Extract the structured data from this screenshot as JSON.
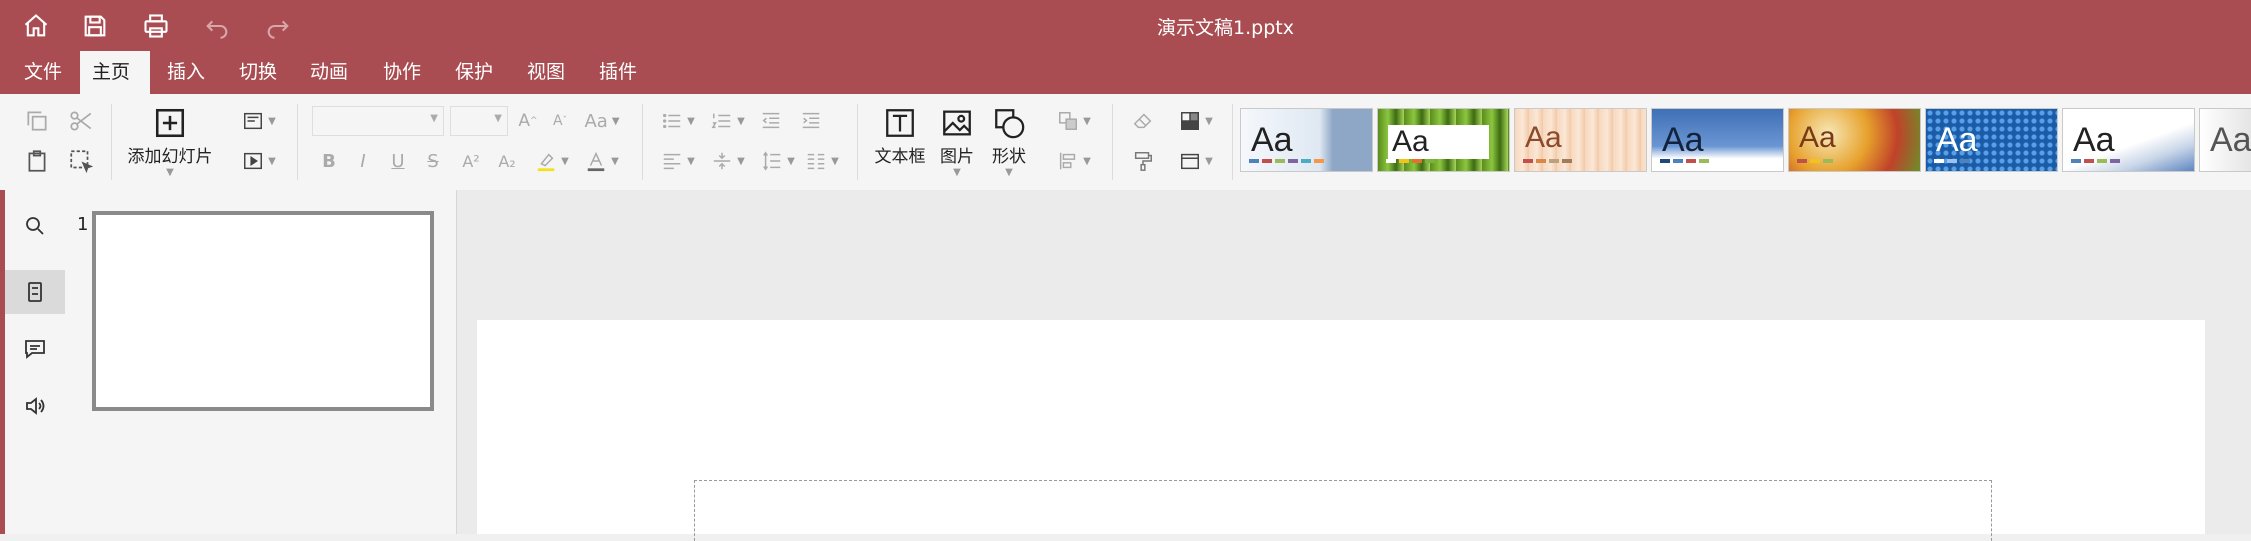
{
  "colors": {
    "accent": "#a94d52",
    "ribbon_bg": "#f5f5f5",
    "canvas_bg": "#ebebeb"
  },
  "titlebar": {
    "document_title": "演示文稿1.pptx",
    "quick_access": [
      "home-icon",
      "save-icon",
      "print-icon",
      "undo-icon",
      "redo-icon"
    ]
  },
  "menu": {
    "items": [
      {
        "label": "文件"
      },
      {
        "label": "主页",
        "active": true
      },
      {
        "label": "插入"
      },
      {
        "label": "切换"
      },
      {
        "label": "动画"
      },
      {
        "label": "协作"
      },
      {
        "label": "保护"
      },
      {
        "label": "视图"
      },
      {
        "label": "插件"
      }
    ]
  },
  "ribbon": {
    "add_slide_label": "添加幻灯片",
    "font_size_decrease_label": "A",
    "font_size_increase_label": "A",
    "change_case_label": "Aa",
    "bold_label": "B",
    "italic_label": "I",
    "underline_label": "U",
    "strike_label": "S",
    "superscript_label": "A²",
    "subscript_label": "A₂",
    "textbox_label": "文本框",
    "picture_label": "图片",
    "shape_label": "形状",
    "themes": [
      {
        "label": "Aa"
      },
      {
        "label": "Aa"
      },
      {
        "label": "Aa"
      },
      {
        "label": "Aa"
      },
      {
        "label": "Aa"
      },
      {
        "label": "Aa"
      },
      {
        "label": "Aa"
      },
      {
        "label": "Aa"
      }
    ]
  },
  "slides_panel": {
    "slides": [
      {
        "number": "1"
      }
    ]
  },
  "left_nav": [
    "search-icon",
    "slides-icon",
    "comment-icon",
    "speaker-icon"
  ]
}
